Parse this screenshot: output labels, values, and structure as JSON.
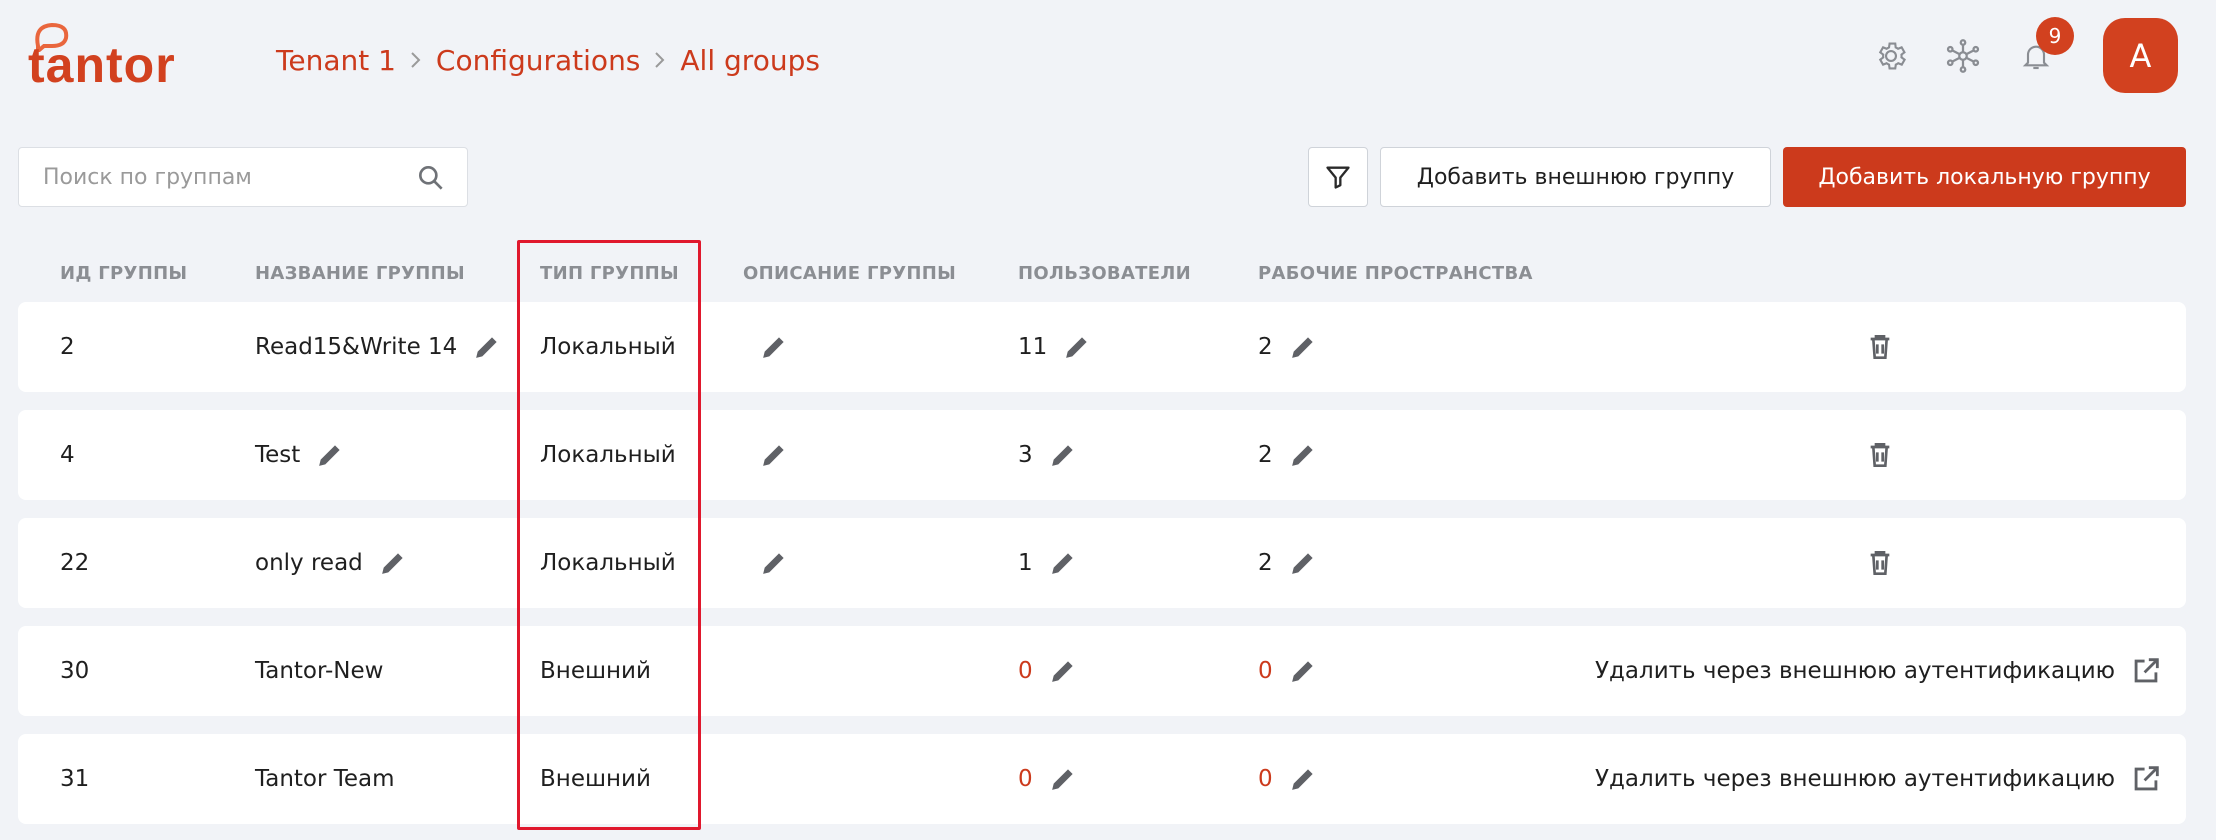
{
  "header": {
    "logo_text": "tantor",
    "breadcrumb": [
      "Tenant 1",
      "Configurations",
      "All groups"
    ],
    "notification_count": "9",
    "avatar_letter": "A"
  },
  "toolbar": {
    "search_placeholder": "Поиск по группам",
    "add_external_label": "Добавить внешнюю группу",
    "add_local_label": "Добавить локальную группу"
  },
  "table": {
    "columns": [
      "ИД ГРУППЫ",
      "НАЗВАНИЕ ГРУППЫ",
      "ТИП ГРУППЫ",
      "ОПИСАНИЕ ГРУППЫ",
      "ПОЛЬЗОВАТЕЛИ",
      "РАБОЧИЕ ПРОСТРАНСТВА"
    ],
    "rows": [
      {
        "id": "2",
        "name": "Read15&Write 14",
        "type": "Локальный",
        "users": "11",
        "workspaces": "2"
      },
      {
        "id": "4",
        "name": "Test",
        "type": "Локальный",
        "users": "3",
        "workspaces": "2"
      },
      {
        "id": "22",
        "name": "only read",
        "type": "Локальный",
        "users": "1",
        "workspaces": "2"
      },
      {
        "id": "30",
        "name": "Tantor-New",
        "type": "Внешний",
        "users": "0",
        "workspaces": "0",
        "external_action": "Удалить через внешнюю аутентификацию"
      },
      {
        "id": "31",
        "name": "Tantor Team",
        "type": "Внешний",
        "users": "0",
        "workspaces": "0",
        "external_action": "Удалить через внешнюю аутентификацию"
      }
    ]
  },
  "colors": {
    "brand": "#cc3a1c",
    "highlight_box": "#e0182d",
    "background": "#f1f3f7"
  },
  "icons": [
    "settings-gear-icon",
    "network-nodes-icon",
    "bell-icon",
    "search-icon",
    "filter-icon",
    "pencil-icon",
    "trash-icon",
    "external-link-icon"
  ]
}
